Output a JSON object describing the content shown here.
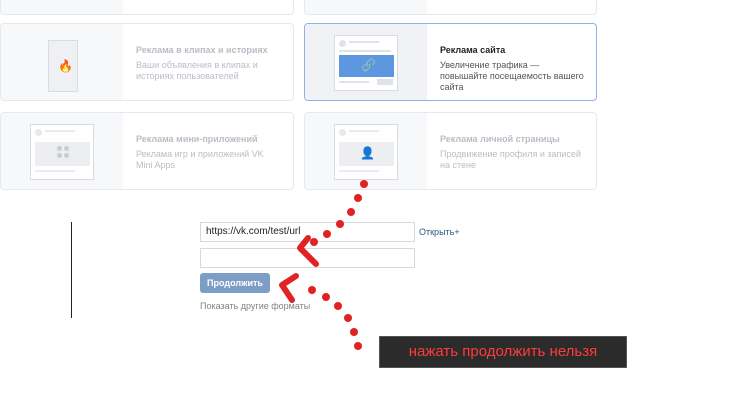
{
  "formats": [
    {
      "title": "Реклама в клипах и историях",
      "desc": "Ваши объявления в клипах и историях пользователей",
      "icon": "fire-icon",
      "selected": false
    },
    {
      "title": "Реклама сайта",
      "desc": "Увеличение трафика — повышайте посещаемость вашего сайта",
      "icon": "link-icon",
      "selected": true
    },
    {
      "title": "Реклама мини-приложений",
      "desc": "Реклама игр и приложений VK Mini Apps",
      "icon": "apps-grid-icon",
      "selected": false
    },
    {
      "title": "Реклама личной страницы",
      "desc": "Продвижение профиля и записей на стене",
      "icon": "user-icon",
      "selected": false
    }
  ],
  "form": {
    "url_value": "https://vk.com/test/url",
    "open_link": "Открыть",
    "second_field_value": "",
    "continue_label": "Продолжить",
    "other_formats": "Показать другие форматы"
  },
  "annotation": {
    "text": "нажать продолжить нельзя",
    "arrow_color": "#e02222"
  },
  "colors": {
    "accent": "#5181b8",
    "button": "#7d9ec4",
    "selected_border": "#8eb4e3"
  }
}
